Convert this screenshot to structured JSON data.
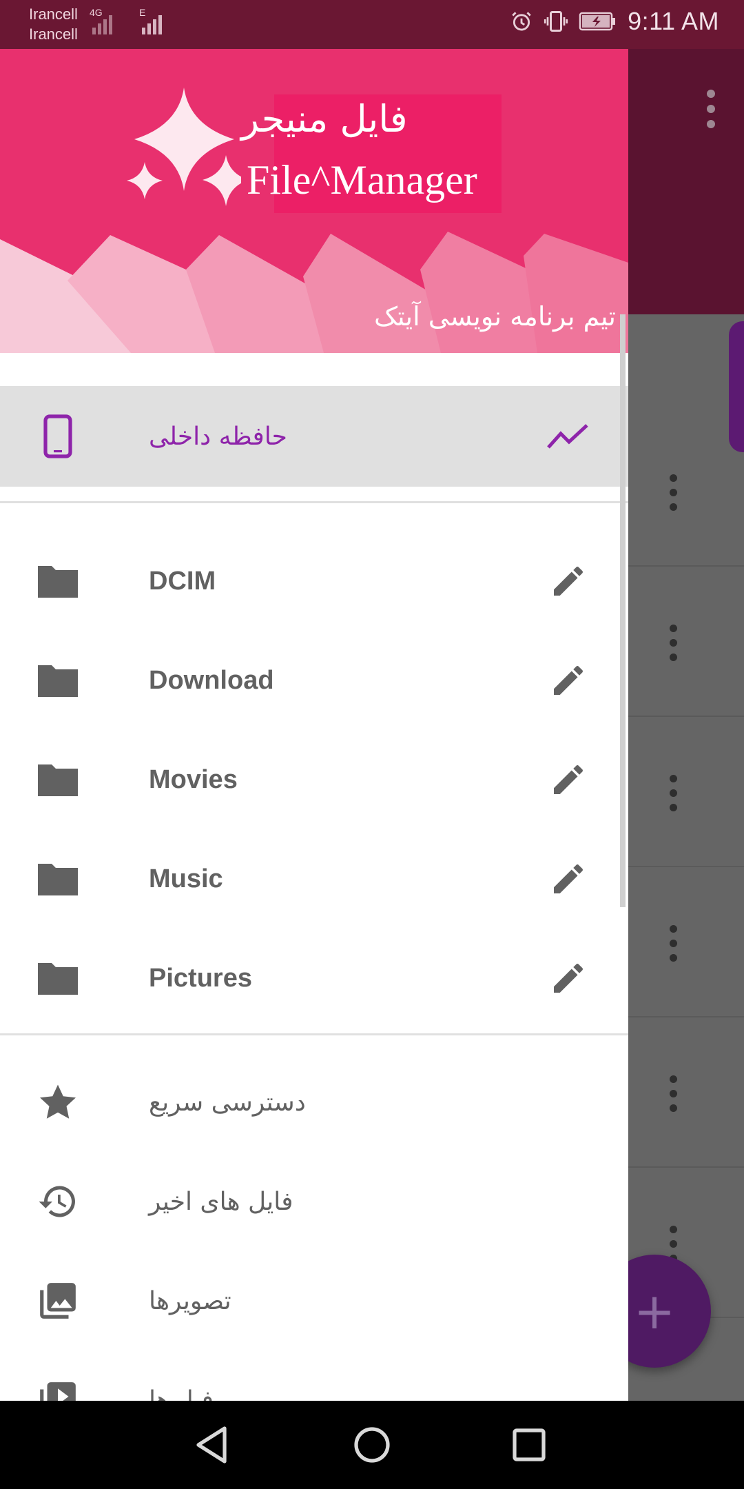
{
  "status_bar": {
    "carrier_1": "Irancell",
    "carrier_2": "Irancell",
    "network_1": "4G",
    "network_2": "E",
    "time": "9:11 AM",
    "icons": [
      "alarm-icon",
      "vibrate-icon",
      "battery-charging-icon"
    ]
  },
  "header": {
    "app_name_fa": "فایل منیجر",
    "app_name_en": "File^Manager",
    "subtitle": "تیم برنامه نویسی آیتک",
    "colors": {
      "header": "#e8306e",
      "title_box": "#ec1f66"
    }
  },
  "storage": {
    "label": "حافظه داخلی",
    "icon": "phone-icon",
    "trailing_icon": "trending-icon",
    "accent": "#8e24aa"
  },
  "folders": [
    {
      "label": "DCIM",
      "icon": "folder-icon",
      "action_icon": "edit-icon"
    },
    {
      "label": "Download",
      "icon": "folder-icon",
      "action_icon": "edit-icon"
    },
    {
      "label": "Movies",
      "icon": "folder-icon",
      "action_icon": "edit-icon"
    },
    {
      "label": "Music",
      "icon": "folder-icon",
      "action_icon": "edit-icon"
    },
    {
      "label": "Pictures",
      "icon": "folder-icon",
      "action_icon": "edit-icon"
    }
  ],
  "menu": [
    {
      "label": "دسترسی سریع",
      "icon": "star-icon"
    },
    {
      "label": "فایل های اخیر",
      "icon": "history-icon"
    },
    {
      "label": "تصویرها",
      "icon": "photo-library-icon"
    },
    {
      "label": "فیلم‌ها",
      "icon": "video-library-icon"
    }
  ],
  "fab": {
    "label": "+"
  },
  "nav": [
    "back-icon",
    "home-icon",
    "recents-icon"
  ]
}
